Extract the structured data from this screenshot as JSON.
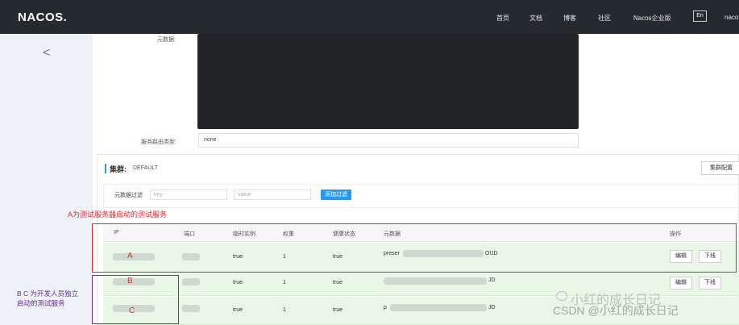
{
  "header": {
    "logo": "NACOS.",
    "nav": [
      "首页",
      "文档",
      "博客",
      "社区",
      "Nacos企业版"
    ],
    "lang": "En",
    "user": "naco"
  },
  "sidebar": {
    "back_icon": "chevron-left-icon",
    "back_glyph": "<"
  },
  "detail": {
    "metadata_label": "元数据:",
    "route_type_label": "服务路由类型:",
    "route_type_value": "none"
  },
  "cluster": {
    "title": "集群:",
    "name": "DEFAULT",
    "config_button": "集群配置",
    "filter": {
      "label": "元数据过滤",
      "key_placeholder": "key",
      "value_placeholder": "value",
      "button": "添加过滤"
    }
  },
  "annotations": {
    "a": "A为测试服务器启动的测试服务",
    "bc_line1": "B C 为开发人员独立",
    "bc_line2": "启动的测试服务"
  },
  "table": {
    "headers": [
      "IP",
      "端口",
      "临时实例",
      "权重",
      "健康状态",
      "元数据",
      "操作"
    ],
    "rows": [
      {
        "letter": "A",
        "ephemeral": "true",
        "weight": "1",
        "healthy": "true",
        "meta_prefix": "preser",
        "meta_suffix": "OUD",
        "edit": "编辑",
        "offline": "下线"
      },
      {
        "letter": "B",
        "ephemeral": "true",
        "weight": "1",
        "healthy": "true",
        "meta_prefix": "",
        "meta_suffix": "JD",
        "edit": "编辑",
        "offline": "下线"
      },
      {
        "letter": "C",
        "ephemeral": "true",
        "weight": "1",
        "healthy": "true",
        "meta_prefix": "p",
        "meta_suffix": "JD",
        "edit": "",
        "offline": ""
      }
    ]
  },
  "watermark": {
    "line1": "小红的成长日记",
    "line2": "CSDN @小红的成长日记"
  },
  "colors": {
    "topbar": "#252a2f",
    "accent": "#209bfa",
    "annotation_red": "#e8282b",
    "annotation_purple": "#7b2f9a",
    "row_green": "#e9f7e6"
  }
}
